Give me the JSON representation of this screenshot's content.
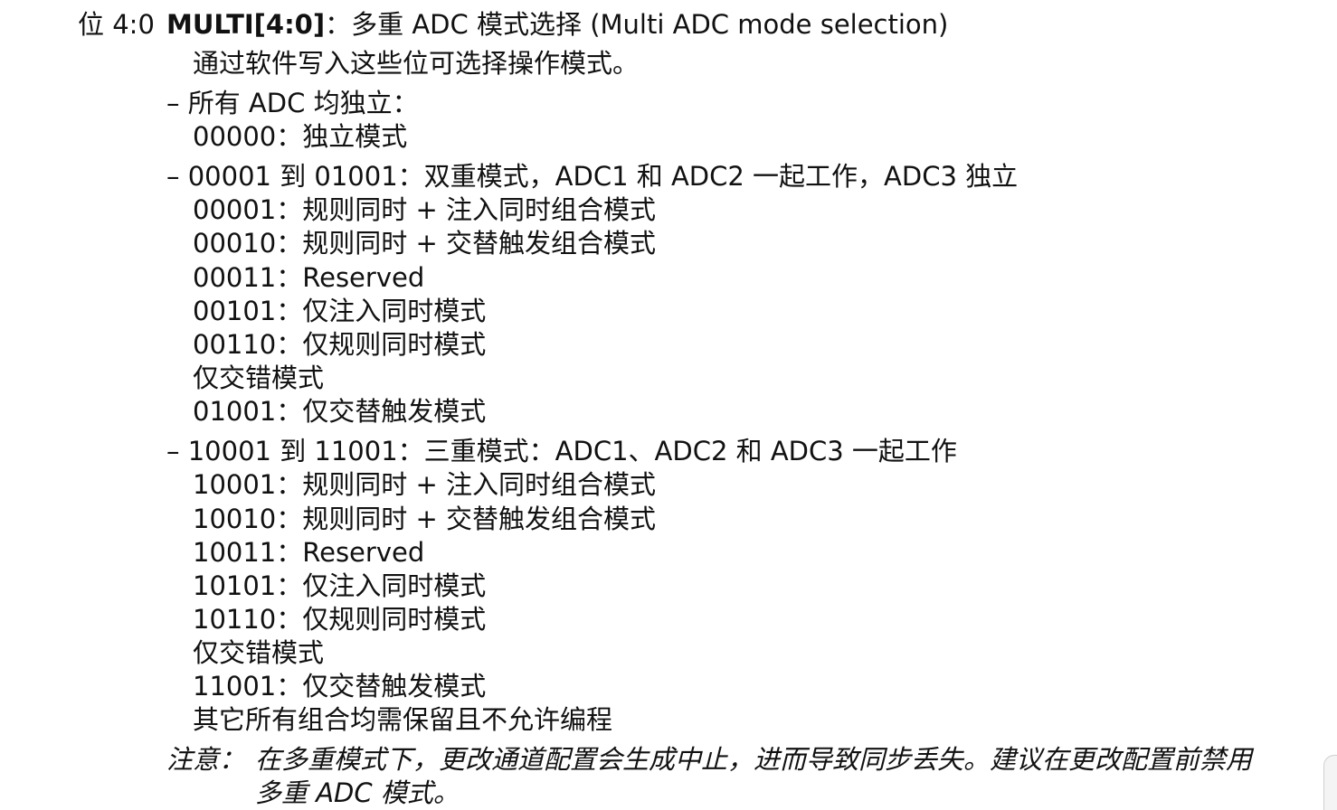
{
  "header": {
    "bit_label": "位 4:0",
    "field_name": "MULTI[4:0]",
    "field_desc": "：多重 ADC 模式选择 (Multi ADC mode selection)"
  },
  "intro": "通过软件写入这些位可选择操作模式。",
  "groups": [
    {
      "heading": "– 所有 ADC 均独立：",
      "items": [
        "00000：独立模式"
      ]
    },
    {
      "heading": "– 00001 到 01001：双重模式，ADC1 和 ADC2 一起工作，ADC3 独立",
      "items": [
        "00001：规则同时 + 注入同时组合模式",
        "00010：规则同时 + 交替触发组合模式",
        "00011：Reserved",
        "00101：仅注入同时模式",
        "00110：仅规则同时模式",
        "仅交错模式",
        "01001：仅交替触发模式"
      ]
    },
    {
      "heading": "– 10001 到 11001：三重模式：ADC1、ADC2 和 ADC3 一起工作",
      "items": [
        "10001：规则同时 + 注入同时组合模式",
        "10010：规则同时 + 交替触发组合模式",
        "10011：Reserved",
        "10101：仅注入同时模式",
        "10110：仅规则同时模式",
        "仅交错模式",
        "11001：仅交替触发模式",
        "其它所有组合均需保留且不允许编程"
      ]
    }
  ],
  "note": {
    "label": "注意：",
    "line1": "在多重模式下，更改通道配置会生成中止，进而导致同步丢失。建议在更改配置前禁用",
    "line2": "多重 ADC 模式。"
  }
}
